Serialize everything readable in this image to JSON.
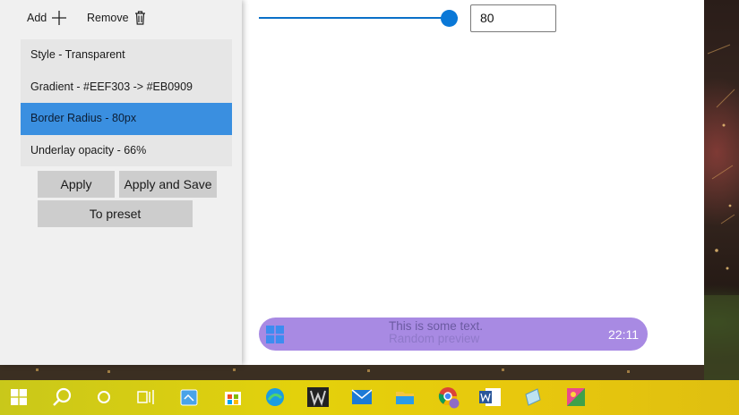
{
  "toolbar": {
    "add_label": "Add",
    "add_icon": "plus-icon",
    "remove_label": "Remove",
    "remove_icon": "trash-icon"
  },
  "layers": [
    {
      "label": "Style - Transparent",
      "selected": false
    },
    {
      "label": "Gradient - #EEF303 -> #EB0909",
      "selected": false
    },
    {
      "label": "Border Radius - 80px",
      "selected": true
    },
    {
      "label": "Underlay opacity - 66%",
      "selected": false
    }
  ],
  "actions": {
    "apply": "Apply",
    "apply_and_save": "Apply and Save",
    "to_preset": "To preset"
  },
  "border_radius": {
    "value": "80",
    "slider_fraction": 1.0
  },
  "preview": {
    "text": "This is some text.",
    "ghost_text": "Random preview",
    "clock": "22:11",
    "background": "#a88ae3"
  },
  "colors": {
    "accent": "#3a8fe0",
    "gradient_start": "#EEF303",
    "gradient_end": "#EB0909"
  },
  "taskbar_icons": [
    "windows-start-icon",
    "search-icon",
    "cortana-icon",
    "task-view-icon",
    "notes-app-icon",
    "microsoft-store-icon",
    "edge-icon",
    "predator-icon",
    "mail-icon",
    "file-explorer-icon",
    "chrome-icon",
    "word-icon",
    "notepad-icon",
    "paint-icon"
  ]
}
